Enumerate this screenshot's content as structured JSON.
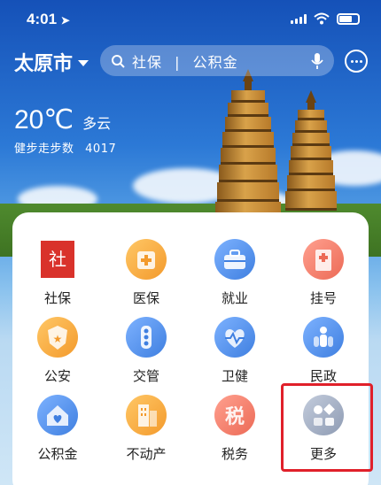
{
  "status_bar": {
    "time": "4:01",
    "icons": [
      "location-arrow-icon",
      "signal-icon",
      "wifi-icon",
      "battery-icon"
    ]
  },
  "header": {
    "city": "太原市",
    "search": {
      "text_1": "社保",
      "separator": "|",
      "text_2": "公积金"
    },
    "more_icon": "ellipsis-circle-icon"
  },
  "weather": {
    "temperature": "20℃",
    "condition": "多云",
    "steps_label": "健步走步数",
    "steps_value": "4017"
  },
  "services": [
    {
      "label": "社保",
      "icon": "shebao-seal-icon",
      "color": "#d9322b"
    },
    {
      "label": "医保",
      "icon": "medical-kit-icon",
      "color": "#f5a13a"
    },
    {
      "label": "就业",
      "icon": "briefcase-icon",
      "color": "#4c8fea"
    },
    {
      "label": "挂号",
      "icon": "hospital-icon",
      "color": "#f07b6a"
    },
    {
      "label": "公安",
      "icon": "police-badge-icon",
      "color": "#f5a13a"
    },
    {
      "label": "交管",
      "icon": "traffic-light-icon",
      "color": "#4c8fea"
    },
    {
      "label": "卫健",
      "icon": "heartbeat-icon",
      "color": "#4c8fea"
    },
    {
      "label": "民政",
      "icon": "people-icon",
      "color": "#4c8fea"
    },
    {
      "label": "公积金",
      "icon": "house-icon",
      "color": "#4c8fea"
    },
    {
      "label": "不动产",
      "icon": "building-icon",
      "color": "#f5a13a"
    },
    {
      "label": "税务",
      "icon": "tax-icon",
      "color": "#f07b6a"
    },
    {
      "label": "更多",
      "icon": "more-grid-icon",
      "color": "#8e9bb3"
    }
  ]
}
